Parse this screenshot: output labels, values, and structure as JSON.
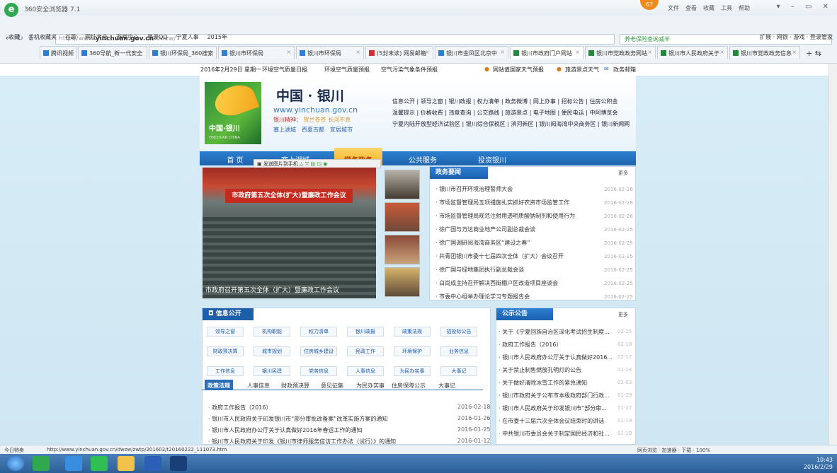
{
  "browser": {
    "title": "360安全浏览器 7.1",
    "badge": "67",
    "menus": [
      "文件",
      "查看",
      "收藏",
      "工具",
      "帮助"
    ],
    "url_prefix": "http://www.",
    "url_domain": "yinchuan.gov.cn",
    "url_path": "/dwzw/",
    "search_placeholder": "养老保险查询减半",
    "bookmarks": [
      "收藏",
      "手机收藏夹",
      "谷歌",
      "网址大全",
      "游戏中心",
      "登录QQ",
      "宁夏人事",
      "2015年"
    ],
    "bookmarks_right": "扩展 · 网银 · 游戏 · 登录管家",
    "tabs": [
      {
        "label": "腾讯视频",
        "active": false
      },
      {
        "label": "360导航_新一代安全",
        "active": false
      },
      {
        "label": "银川环保局_360搜索",
        "active": false
      },
      {
        "label": "银川市环保局",
        "active": false
      },
      {
        "label": "银川市环保局",
        "active": false
      },
      {
        "label": "(5封未读) 网易邮箱",
        "active": false
      },
      {
        "label": "银川市金凤区北京中",
        "active": false
      },
      {
        "label": "银川市政府门户网站",
        "active": true
      },
      {
        "label": "银川市党政政务网站",
        "active": false
      },
      {
        "label": "银川市人民政府关于",
        "active": false
      },
      {
        "label": "银川市党政政务信息",
        "active": false
      }
    ]
  },
  "site": {
    "topbar_date": "2016年2月29日 星期一",
    "topbar_links": [
      "环境空气质量日报",
      "环境空气质量预报",
      "空气污染气象条件预报"
    ],
    "topbar_right": [
      "网站值国家天气预报",
      "旅游景点天气",
      "政务邮箱"
    ],
    "name": "中国 · 银川",
    "url": "www.yinchuan.gov.cn",
    "spirit_label": "银川精神：",
    "spirit_text": "贺兰苍苍 长河不息",
    "city_links": [
      "塞上湖城",
      "西夏古都",
      "宜居城市"
    ],
    "logo_text": "中国·银川",
    "logo_sub": "YINCHUAN CHINA",
    "header_links_1": "信息公开 | 领导之窗 | 银川政报 | 权力清单 | 政务微博 | 网上办事 | 招标公告 | 住房公积金",
    "header_links_2": "温馨提示 | 价格收费 | 违章查询 | 公交路线 | 旅游景点 | 电子地图 | 便民电话 | 中阿博览会",
    "header_links_3": "宁夏内陆开放型经济试验区 | 银川综合保税区 | 滨河新区 | 银川阅海湾中央商务区 | 银川新闻网",
    "nav": [
      "首 页",
      "塞上湖城",
      "党务政务",
      "公共服务",
      "投资银川"
    ],
    "share_toolbar": "发送图片到手机",
    "photo_banner": "市政府第五次全体(扩大)暨廉政工作会议",
    "photo_caption": "市政府召开第五次全体（扩大）暨廉政工作会议"
  },
  "news": {
    "title": "政务要闻",
    "more": "更多",
    "items": [
      {
        "t": "银川市召开环境治理誓师大会",
        "d": "2016-02-26"
      },
      {
        "t": "市场监督管理局五项措施扎实抓好农资市场监管工作",
        "d": "2016-02-26"
      },
      {
        "t": "市场监督管理局规范注射用透明质酸钠制剂和使用行为",
        "d": "2016-02-26"
      },
      {
        "t": "徐广国与万达商业地产公司副总裁会谈",
        "d": "2016-02-25"
      },
      {
        "t": "徐广国调研阅海湾商务区“建设之春”",
        "d": "2016-02-25"
      },
      {
        "t": "共青团银川市委十七届四次全体（扩大）会议召开",
        "d": "2016-02-25"
      },
      {
        "t": "徐广国与绿地集团执行副总裁会谈",
        "d": "2016-02-25"
      },
      {
        "t": "白尚成主持召开解决西街棚户区改造项目座谈会",
        "d": "2016-02-25"
      },
      {
        "t": "市委中心组举办理论学习专题报告会",
        "d": "2016-02-25"
      }
    ]
  },
  "info": {
    "title": "信息公开",
    "buttons": [
      "领导之窗",
      "机构职能",
      "权力清单",
      "银川政报",
      "政策法规",
      "招投标公告",
      "财政预决算",
      "城市规划",
      "住房城乡建设",
      "民政工作",
      "环境保护",
      "业务信息",
      "工作信息",
      "银川民建",
      "党务信息",
      "人事信息",
      "为民办实事",
      "大事记"
    ],
    "subtabs": [
      "政策法规",
      "人事信息",
      "财政预决算",
      "意见征集",
      "为民办实事",
      "住房保障公示",
      "大事记"
    ],
    "items": [
      {
        "t": "政府工作报告（2016）",
        "d": "2016-02-18"
      },
      {
        "t": "银川市人民政府关于印发银川市“部分审批改备案”改革实施方案的通知",
        "d": "2016-01-26"
      },
      {
        "t": "银川市人民政府办公厅关于认真做好2016年春运工作的通知",
        "d": "2016-01-25"
      },
      {
        "t": "银川市人民政府关于印发《银川市律师服务信访工作办法（试行）》的通知",
        "d": "2016-01-12"
      }
    ]
  },
  "notice": {
    "title": "公示公告",
    "more": "更多",
    "items": [
      {
        "t": "关于《宁夏回族自治区深化考试招生制度...",
        "d": "02-25"
      },
      {
        "t": "政府工作报告（2016）",
        "d": "02-18"
      },
      {
        "t": "银川市人民政府办公厅关于认真做好2016...",
        "d": "02-17"
      },
      {
        "t": "关于禁止制售燃放孔明灯的公告",
        "d": "02-14"
      },
      {
        "t": "关于做好清除冰雪工作的紧急通知",
        "d": "02-03"
      },
      {
        "t": "银川市政府关于公布市本级政府部门行政...",
        "d": "01-29"
      },
      {
        "t": "银川市人民政府关于印发银川市“部分审...",
        "d": "01-27"
      },
      {
        "t": "在市委十三届六次全体会议结束时的讲话",
        "d": "01-19"
      },
      {
        "t": "中共银川市委员会关于制定国民经济和社...",
        "d": "01-19"
      }
    ]
  },
  "status": {
    "left": "今日特卖",
    "url": "http://www.yinchuan.gov.cn/dwzw/zwtp/201602/t20160222_111073.htm",
    "right": "网页浏览 · 加速器 · 下载 · 100%"
  },
  "taskbar": {
    "time": "10:43",
    "date": "2016/2/29"
  }
}
